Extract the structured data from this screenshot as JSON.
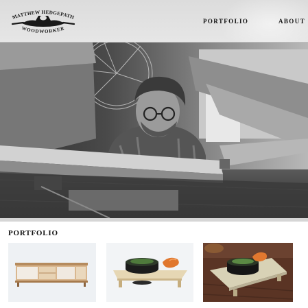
{
  "header": {
    "logo": {
      "name_line": "MATTHEW HEDGEPATH",
      "trade_line": "WOODWORKER",
      "icon": "wood-plane-icon"
    },
    "nav": {
      "portfolio_label": "PORTFOLIO",
      "about_label": "ABOUT"
    }
  },
  "hero": {
    "image": "woodworker-at-workbench-photo"
  },
  "portfolio": {
    "title": "PORTFOLIO",
    "items": [
      {
        "image": "wooden-media-console-photo"
      },
      {
        "image": "serving-tray-with-bowl-photo"
      },
      {
        "image": "serving-tray-on-table-photo"
      }
    ]
  },
  "colors": {
    "header_bg": "#e0e0e0",
    "text": "#111111",
    "thumb_dark_bg": "#5a3424"
  }
}
